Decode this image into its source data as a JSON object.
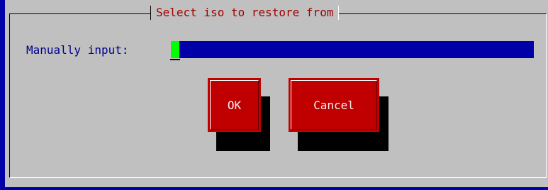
{
  "dialog": {
    "title": "Select iso to restore from",
    "input_label": "Manually input:",
    "input_value": ""
  },
  "buttons": {
    "ok_label": "OK",
    "cancel_label": "Cancel"
  },
  "colors": {
    "screen_background": "#0000a8",
    "dialog_background": "#c0c0c0",
    "title_text": "#a00000",
    "label_text": "#00008b",
    "input_background": "#0000a8",
    "cursor": "#00ff00",
    "button_background": "#c00000",
    "button_text": "#f2f2f2"
  }
}
